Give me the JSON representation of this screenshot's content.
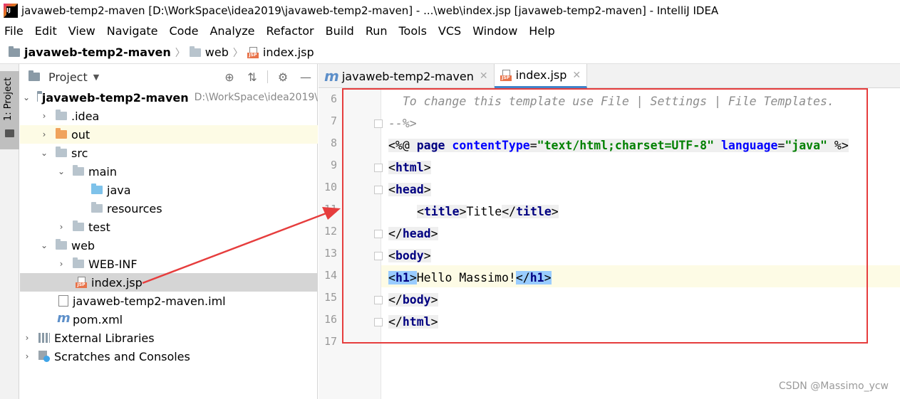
{
  "window": {
    "title": "javaweb-temp2-maven [D:\\WorkSpace\\idea2019\\javaweb-temp2-maven] - ...\\web\\index.jsp [javaweb-temp2-maven] - IntelliJ IDEA",
    "logo_text": "IJ"
  },
  "menu": [
    "File",
    "Edit",
    "View",
    "Navigate",
    "Code",
    "Analyze",
    "Refactor",
    "Build",
    "Run",
    "Tools",
    "VCS",
    "Window",
    "Help"
  ],
  "breadcrumb": [
    "javaweb-temp2-maven",
    "web",
    "index.jsp"
  ],
  "tool_stripe": {
    "label": "1: Project"
  },
  "project_panel": {
    "title": "Project",
    "tree": [
      {
        "label": "javaweb-temp2-maven",
        "path": "D:\\WorkSpace\\idea2019\\"
      },
      {
        "label": ".idea"
      },
      {
        "label": "out"
      },
      {
        "label": "src"
      },
      {
        "label": "main"
      },
      {
        "label": "java"
      },
      {
        "label": "resources"
      },
      {
        "label": "test"
      },
      {
        "label": "web"
      },
      {
        "label": "WEB-INF"
      },
      {
        "label": "index.jsp"
      },
      {
        "label": "javaweb-temp2-maven.iml"
      },
      {
        "label": "pom.xml"
      },
      {
        "label": "External Libraries"
      },
      {
        "label": "Scratches and Consoles"
      }
    ]
  },
  "editor": {
    "tabs": [
      {
        "label": "javaweb-temp2-maven",
        "icon": "m"
      },
      {
        "label": "index.jsp",
        "icon": "JSP"
      }
    ],
    "lines": [
      {
        "no": "6",
        "text": "  To change this template use File | Settings | File Templates."
      },
      {
        "no": "7",
        "text": "--%>"
      },
      {
        "no": "8",
        "p1": "<%@ ",
        "kw": "page",
        "a1": " contentType",
        "e1": "=",
        "s1": "\"text/html;charset=UTF-8\"",
        "a2": " language",
        "e2": "=",
        "s2": "\"java\"",
        "p2": " %>"
      },
      {
        "no": "9",
        "open": "<",
        "tag": "html",
        "close": ">"
      },
      {
        "no": "10",
        "open": "<",
        "tag": "head",
        "close": ">"
      },
      {
        "no": "11",
        "open": "<",
        "tag": "title",
        "close": ">",
        "inner": "Title",
        "open2": "</",
        "tag2": "title",
        "close2": ">"
      },
      {
        "no": "12",
        "open": "</",
        "tag": "head",
        "close": ">"
      },
      {
        "no": "13",
        "open": "<",
        "tag": "body",
        "close": ">"
      },
      {
        "no": "14",
        "open": "<",
        "tag": "h1",
        "close": ">",
        "inner": "Hello Massimo!",
        "open2": "</",
        "tag2": "h1",
        "close2": ">"
      },
      {
        "no": "15",
        "open": "</",
        "tag": "body",
        "close": ">"
      },
      {
        "no": "16",
        "open": "</",
        "tag": "html",
        "close": ">"
      },
      {
        "no": "17"
      }
    ]
  },
  "watermark": "CSDN @Massimo_ycw",
  "colors": {
    "annotation": "#e63d3d",
    "selection": "#99ccff",
    "current_line": "#fdfbe5"
  }
}
